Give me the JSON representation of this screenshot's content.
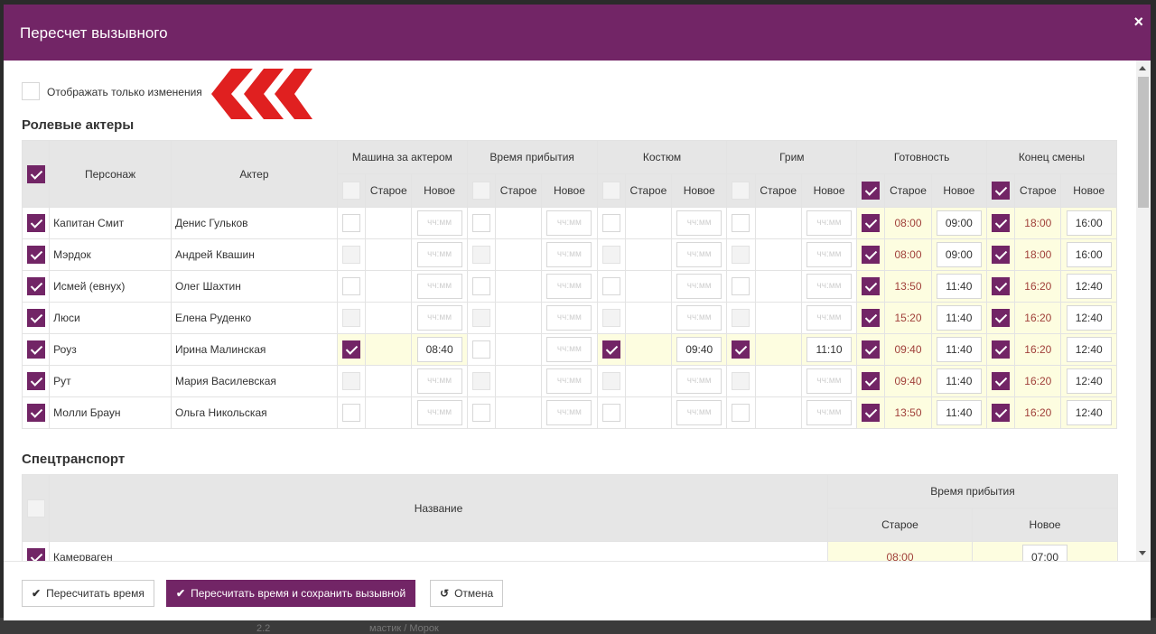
{
  "dialog": {
    "title": "Пересчет вызывного",
    "close_icon": "×"
  },
  "filter": {
    "label": "Отображать только изменения",
    "checked": false
  },
  "actors_section": {
    "title": "Ролевые актеры",
    "headers": {
      "character": "Персонаж",
      "actor": "Актер",
      "groups": [
        "Машина за актером",
        "Время прибытия",
        "Костюм",
        "Грим",
        "Готовность",
        "Конец смены"
      ],
      "old": "Старое",
      "new": "Новое"
    },
    "placeholder": "чч:мм",
    "rows": [
      {
        "character": "Капитан Смит",
        "actor": "Денис Гульков",
        "car": {
          "cb": false,
          "old": "",
          "new": ""
        },
        "arrival": {
          "cb": false,
          "old": "",
          "new": ""
        },
        "costume": {
          "cb": false,
          "old": "",
          "new": ""
        },
        "makeup": {
          "cb": false,
          "old": "",
          "new": ""
        },
        "ready": {
          "old": "08:00",
          "new": "09:00"
        },
        "end": {
          "old": "18:00",
          "new": "16:00"
        }
      },
      {
        "character": "Мэрдок",
        "actor": "Андрей Квашин",
        "car": {
          "cb": false,
          "old": "",
          "new": ""
        },
        "arrival": {
          "cb": false,
          "old": "",
          "new": ""
        },
        "costume": {
          "cb": false,
          "old": "",
          "new": ""
        },
        "makeup": {
          "cb": false,
          "old": "",
          "new": ""
        },
        "ready": {
          "old": "08:00",
          "new": "09:00"
        },
        "end": {
          "old": "18:00",
          "new": "16:00"
        }
      },
      {
        "character": "Исмей (евнух)",
        "actor": "Олег Шахтин",
        "car": {
          "cb": false,
          "old": "",
          "new": ""
        },
        "arrival": {
          "cb": false,
          "old": "",
          "new": ""
        },
        "costume": {
          "cb": false,
          "old": "",
          "new": ""
        },
        "makeup": {
          "cb": false,
          "old": "",
          "new": ""
        },
        "ready": {
          "old": "13:50",
          "new": "11:40"
        },
        "end": {
          "old": "16:20",
          "new": "12:40"
        }
      },
      {
        "character": "Люси",
        "actor": "Елена Руденко",
        "car": {
          "cb": false,
          "old": "",
          "new": ""
        },
        "arrival": {
          "cb": false,
          "old": "",
          "new": ""
        },
        "costume": {
          "cb": false,
          "old": "",
          "new": ""
        },
        "makeup": {
          "cb": false,
          "old": "",
          "new": ""
        },
        "ready": {
          "old": "15:20",
          "new": "11:40"
        },
        "end": {
          "old": "16:20",
          "new": "12:40"
        }
      },
      {
        "character": "Роуз",
        "actor": "Ирина Малинская",
        "car": {
          "cb": true,
          "old": "",
          "new": "08:40"
        },
        "arrival": {
          "cb": false,
          "old": "",
          "new": ""
        },
        "costume": {
          "cb": true,
          "old": "",
          "new": "09:40"
        },
        "makeup": {
          "cb": true,
          "old": "",
          "new": "11:10"
        },
        "ready": {
          "old": "09:40",
          "new": "11:40"
        },
        "end": {
          "old": "16:20",
          "new": "12:40"
        }
      },
      {
        "character": "Рут",
        "actor": "Мария Василевская",
        "car": {
          "cb": false,
          "old": "",
          "new": ""
        },
        "arrival": {
          "cb": false,
          "old": "",
          "new": ""
        },
        "costume": {
          "cb": false,
          "old": "",
          "new": ""
        },
        "makeup": {
          "cb": false,
          "old": "",
          "new": ""
        },
        "ready": {
          "old": "09:40",
          "new": "11:40"
        },
        "end": {
          "old": "16:20",
          "new": "12:40"
        }
      },
      {
        "character": "Молли Браун",
        "actor": "Ольга Никольская",
        "car": {
          "cb": false,
          "old": "",
          "new": ""
        },
        "arrival": {
          "cb": false,
          "old": "",
          "new": ""
        },
        "costume": {
          "cb": false,
          "old": "",
          "new": ""
        },
        "makeup": {
          "cb": false,
          "old": "",
          "new": ""
        },
        "ready": {
          "old": "13:50",
          "new": "11:40"
        },
        "end": {
          "old": "16:20",
          "new": "12:40"
        }
      }
    ]
  },
  "transport_section": {
    "title": "Спецтранспорт",
    "headers": {
      "name": "Название",
      "arrival": "Время прибытия",
      "old": "Старое",
      "new": "Новое"
    },
    "rows": [
      {
        "name": "Камерваген",
        "old": "08:00",
        "new": "07:00"
      }
    ]
  },
  "footer": {
    "recalc_label": "Пересчитать время",
    "recalc_save_label": "Пересчитать время и сохранить вызывной",
    "cancel_label": "Отмена",
    "check_icon": "✔",
    "undo_icon": "↺"
  },
  "background": {
    "left_text": "2.2",
    "right_text": "мастик / Морок"
  },
  "colors": {
    "brand": "#722566",
    "old_time": "#a0403a",
    "highlight": "#fdfde0"
  }
}
